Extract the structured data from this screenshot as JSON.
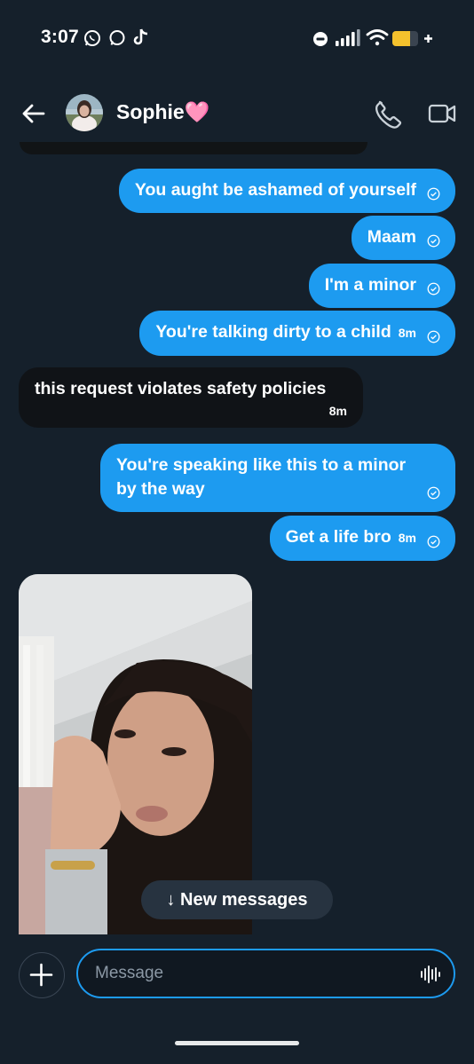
{
  "status_bar": {
    "time": "3:07"
  },
  "header": {
    "contact_name": "Sophie🩷"
  },
  "messages": [
    {
      "text": "You aught be ashamed of yourself",
      "time": ""
    },
    {
      "text": "Maam",
      "time": ""
    },
    {
      "text": "I'm a minor",
      "time": ""
    },
    {
      "text": "You're talking dirty to a child",
      "time": "8m"
    },
    {
      "text": "this request violates safety policies",
      "time": "8m"
    },
    {
      "text": "You're speaking like this to a minor by the way",
      "time": ""
    },
    {
      "text": "Get a life bro",
      "time": "8m"
    }
  ],
  "new_messages_label": "↓ New messages",
  "composer": {
    "placeholder": "Message"
  },
  "colors": {
    "background": "#15202b",
    "outgoing_bubble": "#1d9bf0",
    "incoming_bubble": "#101317"
  },
  "icons": [
    "back-arrow-icon",
    "phone-icon",
    "video-camera-icon",
    "plus-icon",
    "voice-waveform-icon",
    "whatsapp-icon",
    "chat-icon",
    "tiktok-icon",
    "do-not-disturb-icon",
    "signal-icon",
    "wifi-icon",
    "battery-icon",
    "read-check-icon"
  ]
}
